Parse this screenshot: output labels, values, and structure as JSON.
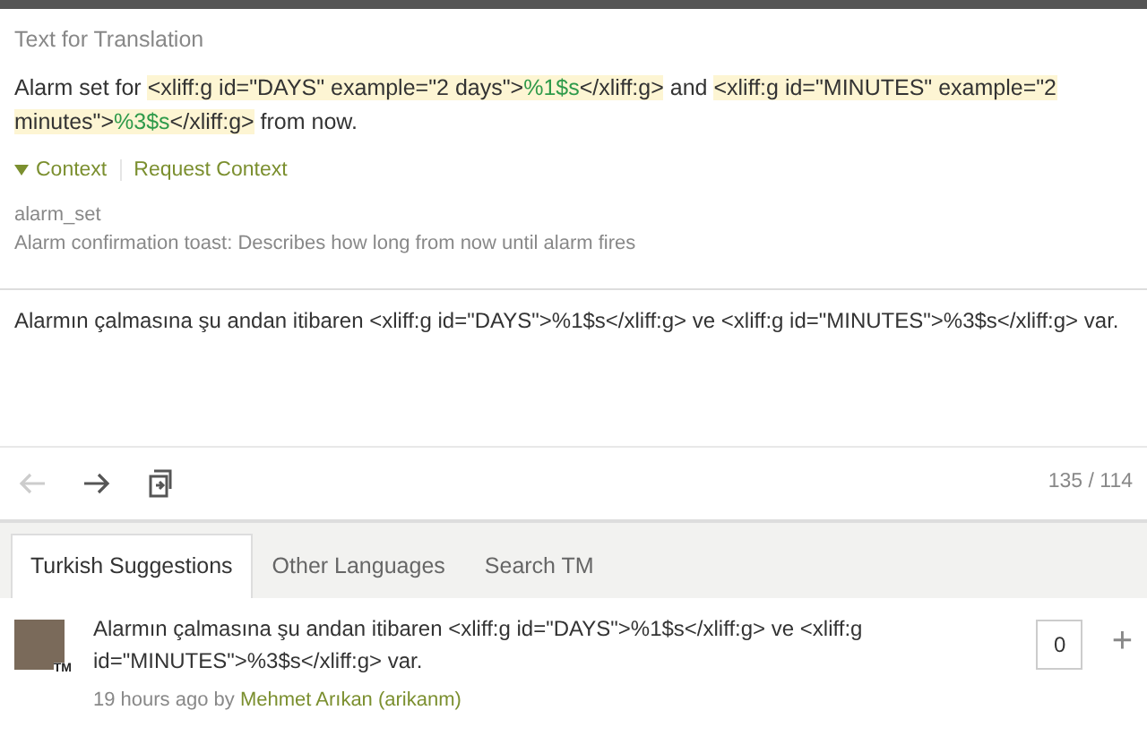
{
  "source": {
    "heading": "Text for Translation",
    "segments": [
      {
        "kind": "plain",
        "text": "Alarm set for "
      },
      {
        "kind": "tag",
        "text": "<xliff:g id=\"DAYS\" example=\"2 days\">"
      },
      {
        "kind": "placeholder",
        "text": "%1$s"
      },
      {
        "kind": "tag",
        "text": "</xliff:g>"
      },
      {
        "kind": "plain",
        "text": " and "
      },
      {
        "kind": "tag",
        "text": "<xliff:g id=\"MINUTES\" example=\"2 minutes\">"
      },
      {
        "kind": "placeholder",
        "text": "%3$s"
      },
      {
        "kind": "tag",
        "text": "</xliff:g>"
      },
      {
        "kind": "plain",
        "text": " from now."
      }
    ]
  },
  "context": {
    "expanded": true,
    "toggle": "Context",
    "request": "Request Context",
    "key": "alarm_set",
    "description": "Alarm confirmation toast: Describes how long from now until alarm fires"
  },
  "translation": {
    "value": "Alarmın çalmasına şu andan itibaren <xliff:g id=\"DAYS\">%1$s</xliff:g> ve <xliff:g id=\"MINUTES\">%3$s</xliff:g> var.",
    "prev_disabled": true,
    "counter": "135 / 114"
  },
  "tabs": [
    {
      "label": "Turkish Suggestions",
      "selected": true
    },
    {
      "label": "Other Languages",
      "selected": false
    },
    {
      "label": "Search TM",
      "selected": false
    }
  ],
  "suggestions": [
    {
      "text": "Alarmın çalmasına şu andan itibaren <xliff:g id=\"DAYS\">%1$s</xliff:g> ve <xliff:g id=\"MINUTES\">%3$s</xliff:g> var.",
      "badge": "TM",
      "time": "19 hours ago by",
      "author": "Mehmet Arıkan (arikanm)",
      "votes": "0",
      "action": "+"
    }
  ]
}
